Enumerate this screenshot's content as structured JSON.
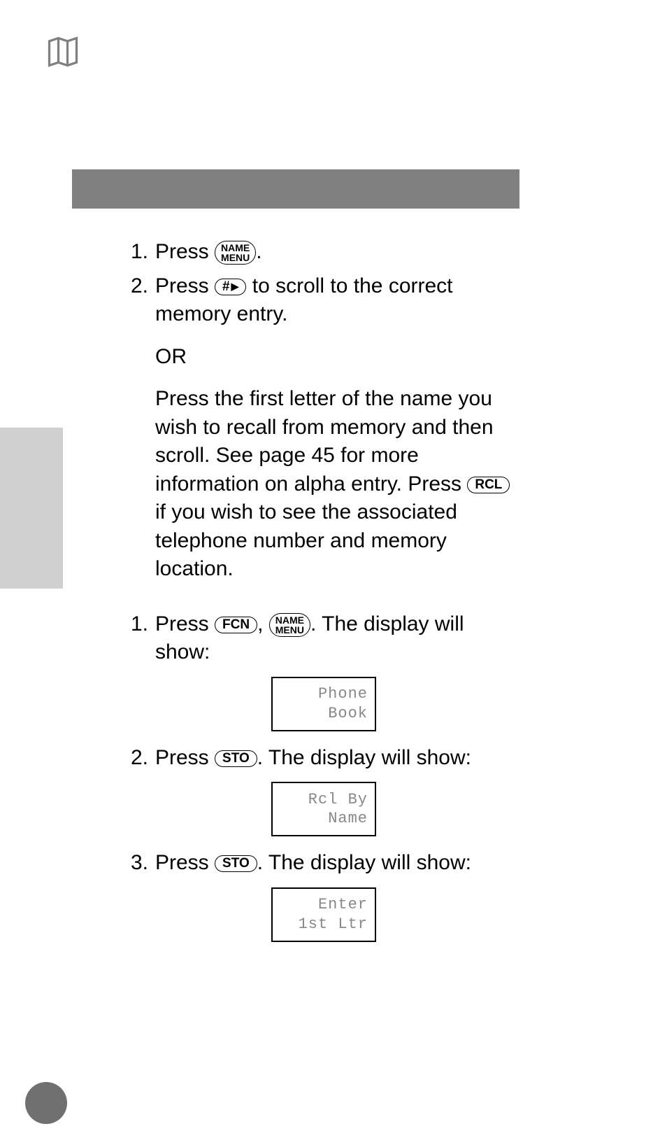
{
  "icons": {
    "map": "map-icon"
  },
  "keys": {
    "name_menu_top": "NAME",
    "name_menu_bottom": "MENU",
    "hash": "#",
    "rcl": "RCL",
    "fcn": "FCN",
    "sto": "STO"
  },
  "section1": {
    "step1": {
      "num": "1.",
      "text_before": "Press ",
      "text_after": "."
    },
    "step2": {
      "num": "2.",
      "text_before": "Press ",
      "text_after": " to scroll to the correct memory entry."
    },
    "or": "OR",
    "paragraph": {
      "part1": "Press the first letter of the name you wish to recall from memory and then scroll. See page 45 for more information on alpha entry. Press ",
      "part2": " if you wish to see the associated telephone number and memory location."
    }
  },
  "section2": {
    "step1": {
      "num": "1.",
      "text_before": "Press ",
      "text_mid": ", ",
      "text_after": ". The display will show:"
    },
    "display1": {
      "line1": "Phone",
      "line2": "Book"
    },
    "step2": {
      "num": "2.",
      "text_before": "Press ",
      "text_after": ". The display will show:"
    },
    "display2": {
      "line1": "Rcl By",
      "line2": "Name"
    },
    "step3": {
      "num": "3.",
      "text_before": "Press ",
      "text_after": ". The display will show:"
    },
    "display3": {
      "line1": "Enter",
      "line2": "1st Ltr"
    }
  }
}
